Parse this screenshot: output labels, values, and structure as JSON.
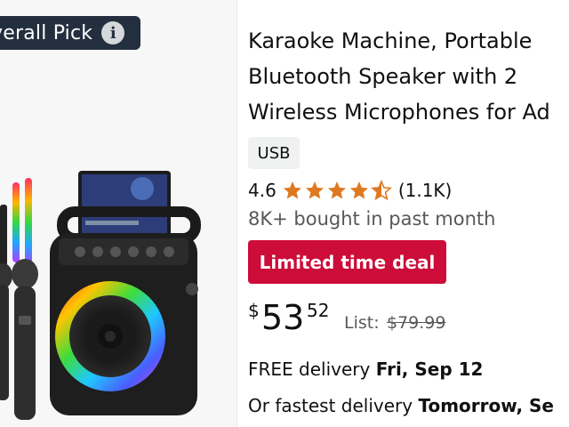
{
  "badge": {
    "text": "verall Pick",
    "info_icon": "info-icon"
  },
  "product": {
    "title_lines": [
      "Karaoke Machine, Portable",
      "Bluetooth Speaker with 2",
      "Wireless Microphones for Ad"
    ],
    "variant": "USB",
    "rating": {
      "value": "4.6",
      "stars": 4.5,
      "count": "(1.1K)"
    },
    "bought": "8K+ bought in past month",
    "deal_label": "Limited time deal",
    "price": {
      "symbol": "$",
      "whole": "53",
      "fraction": "52"
    },
    "list_label": "List:",
    "list_price": "$79.99",
    "delivery": {
      "prefix": "FREE delivery",
      "date": "Fri, Sep 12"
    },
    "fastest": {
      "prefix": "Or fastest delivery",
      "date": "Tomorrow, Se"
    }
  },
  "colors": {
    "badge_bg": "#232f3e",
    "deal_bg": "#cc0c39",
    "star": "#de7921",
    "muted_text": "#565959"
  }
}
